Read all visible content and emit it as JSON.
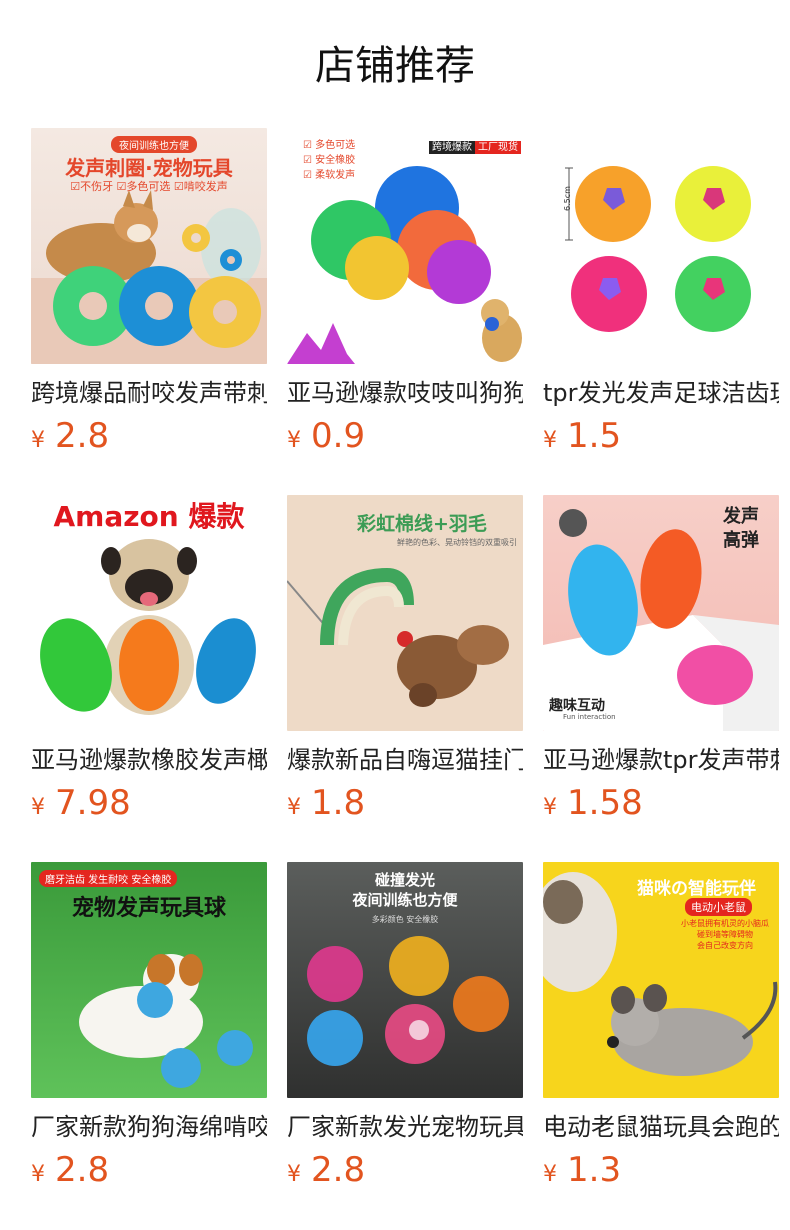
{
  "page": {
    "title": "店铺推荐"
  },
  "currency_symbol": "¥",
  "products": [
    {
      "name": "跨境爆品耐咬发声带刺圈宠物玩具",
      "price": "2.8",
      "image_text": {
        "badge": "夜间训练也方便",
        "headline": "发声刺圈·宠物玩具",
        "features": "☑不伤牙  ☑多色可选  ☑啃咬发声"
      }
    },
    {
      "name": "亚马逊爆款吱吱叫狗狗玩具球",
      "price": "0.9",
      "image_text": {
        "features": [
          "☑ 多色可选",
          "☑ 安全橡胶",
          "☑ 柔软发声"
        ],
        "tag_left": "跨境爆款",
        "tag_right": "工厂现货"
      }
    },
    {
      "name": "tpr发光发声足球洁齿玩具",
      "price": "1.5",
      "image_text": {
        "dimension": "6.5cm"
      }
    },
    {
      "name": "亚马逊爆款橡胶发声橄榄球",
      "price": "7.98",
      "image_text": {
        "headline": "Amazon 爆款"
      }
    },
    {
      "name": "爆款新品自嗨逗猫挂门玩具",
      "price": "1.8",
      "image_text": {
        "headline": "彩虹棉线+羽毛",
        "subline": "鲜艳的色彩、晃动铃铛的双重吸引"
      }
    },
    {
      "name": "亚马逊爆款tpr发声带刺球",
      "price": "1.58",
      "image_text": {
        "headline": "发声\n高弹",
        "caption": "趣味互动",
        "caption_sub": "Fun interaction"
      }
    },
    {
      "name": "厂家新款狗狗海绵啃咬发声球",
      "price": "2.8",
      "image_text": {
        "badge": "磨牙洁齿 发生耐咬 安全橡胶",
        "headline": "宠物发声玩具球"
      }
    },
    {
      "name": "厂家新款发光宠物玩具球",
      "price": "2.8",
      "image_text": {
        "headline": "碰撞发光\n夜间训练也方便",
        "subline": "多彩颜色 安全橡胶"
      }
    },
    {
      "name": "电动老鼠猫玩具会跑的小老鼠",
      "price": "1.3",
      "image_text": {
        "headline": "猫咪の智能玩伴",
        "badge": "电动小老鼠",
        "subline": "小老鼠拥有机灵的小脑瓜\n碰到墙等障碍物\n会自己改变方向"
      }
    }
  ],
  "colors": {
    "price": "#e2541f",
    "text": "#222222"
  }
}
